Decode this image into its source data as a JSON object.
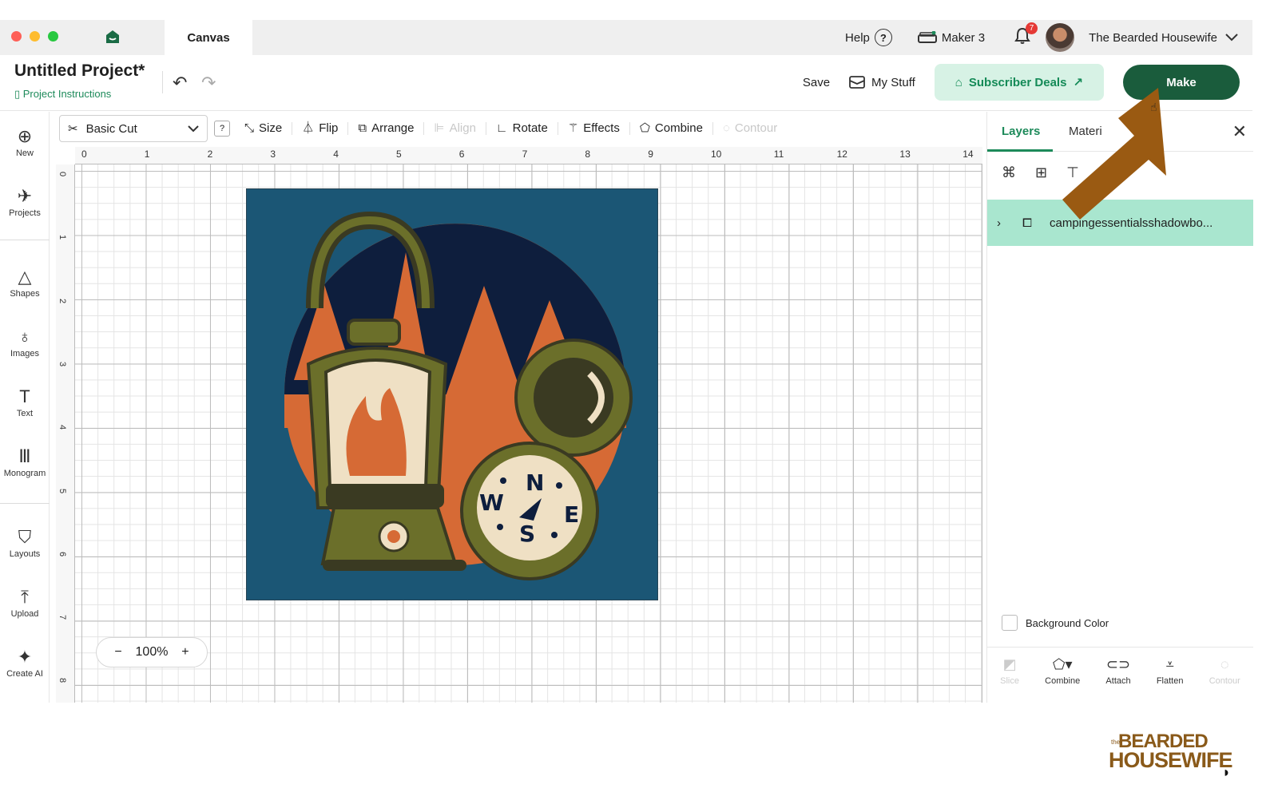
{
  "window": {
    "tab_label": "Canvas",
    "help_label": "Help",
    "help_icon_glyph": "?",
    "machine_label": "Maker 3",
    "notification_count": "7",
    "user_name": "The Bearded Housewife"
  },
  "header": {
    "project_title": "Untitled Project*",
    "project_instructions": "Project Instructions",
    "save_label": "Save",
    "my_stuff_label": "My Stuff",
    "subscriber_deals_label": "Subscriber Deals",
    "make_label": "Make"
  },
  "sidebar": {
    "items": [
      {
        "label": "New",
        "icon": "plus-circle-icon"
      },
      {
        "label": "Projects",
        "icon": "rocket-icon"
      },
      {
        "label": "Shapes",
        "icon": "shapes-icon"
      },
      {
        "label": "Images",
        "icon": "lightbulb-icon"
      },
      {
        "label": "Text",
        "icon": "text-icon"
      },
      {
        "label": "Monogram",
        "icon": "monogram-icon"
      },
      {
        "label": "Layouts",
        "icon": "tshirt-icon"
      },
      {
        "label": "Upload",
        "icon": "upload-icon"
      },
      {
        "label": "Create AI",
        "icon": "sparkle-icon"
      }
    ]
  },
  "toolbar": {
    "operation": "Basic Cut",
    "help_glyph": "?",
    "size": "Size",
    "flip": "Flip",
    "arrange": "Arrange",
    "align": "Align",
    "rotate": "Rotate",
    "effects": "Effects",
    "combine": "Combine",
    "contour": "Contour"
  },
  "canvas": {
    "ruler_top": [
      "0",
      "1",
      "2",
      "3",
      "4",
      "5",
      "6",
      "7",
      "8",
      "9",
      "10",
      "11",
      "12",
      "13",
      "14"
    ],
    "ruler_left": [
      "0",
      "1",
      "2",
      "3",
      "4",
      "5",
      "6",
      "7",
      "8"
    ],
    "compass_letters": {
      "n": "N",
      "w": "W",
      "e": "E",
      "s": "S"
    },
    "zoom": {
      "minus": "−",
      "value": "100%",
      "plus": "+"
    }
  },
  "panel": {
    "tab_layers": "Layers",
    "tab_materials": "Materi",
    "layer_name": "campingessentialsshadowbo...",
    "background_color_label": "Background Color",
    "bottom_tools": [
      {
        "label": "Slice",
        "enabled": false
      },
      {
        "label": "Combine",
        "enabled": true
      },
      {
        "label": "Attach",
        "enabled": true
      },
      {
        "label": "Flatten",
        "enabled": true
      },
      {
        "label": "Contour",
        "enabled": false
      }
    ]
  },
  "watermark": {
    "small": "the",
    "line1": "BEARDED",
    "line2": "HOUSEWIFE"
  },
  "colors": {
    "accent_green": "#1d8a5a",
    "make_button": "#1a5c3c",
    "layer_highlight": "#a9e6cf",
    "arrow": "#9a5a12",
    "art_background": "#1b5675",
    "art_orange": "#d66a35",
    "art_olive": "#6b6f2a"
  }
}
